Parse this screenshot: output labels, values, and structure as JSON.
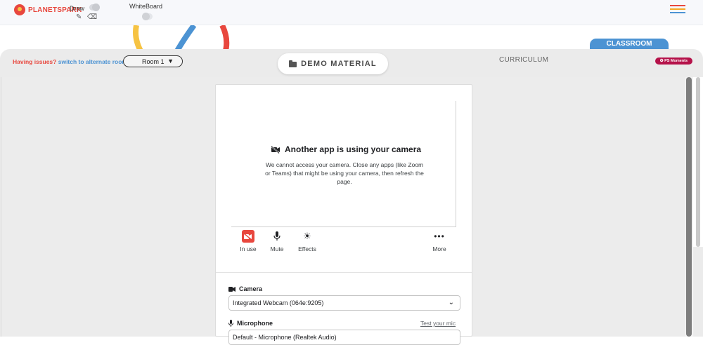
{
  "brand": {
    "name": "PLANETSPARK"
  },
  "toolbar": {
    "draw_label": "Draw",
    "whiteboard_label": "WhiteBoard"
  },
  "menu_colors": [
    "#e8473e",
    "#f6a623",
    "#4c93d3"
  ],
  "header": {
    "issues_question": "Having issues?",
    "issues_link": "switch to alternate room",
    "room_selected": "Room 1",
    "demo_material": "DEMO MATERIAL",
    "curriculum": "CURRICULUM",
    "classroom": "CLASSROOM",
    "ps_moments": "PS Moments"
  },
  "camera_panel": {
    "title": "Another app is using your camera",
    "message": "We cannot access your camera. Close any apps (like Zoom or Teams) that might be using your camera, then refresh the page.",
    "controls": {
      "in_use": "In use",
      "mute": "Mute",
      "effects": "Effects",
      "more": "More"
    },
    "camera_label": "Camera",
    "camera_value": "Integrated Webcam (064e:9205)",
    "microphone_label": "Microphone",
    "test_mic": "Test your mic",
    "microphone_value": "Default - Microphone (Realtek Audio)"
  },
  "colors": {
    "accent_blue": "#4c93d3",
    "accent_red": "#e8473e",
    "badge": "#b5124a"
  }
}
